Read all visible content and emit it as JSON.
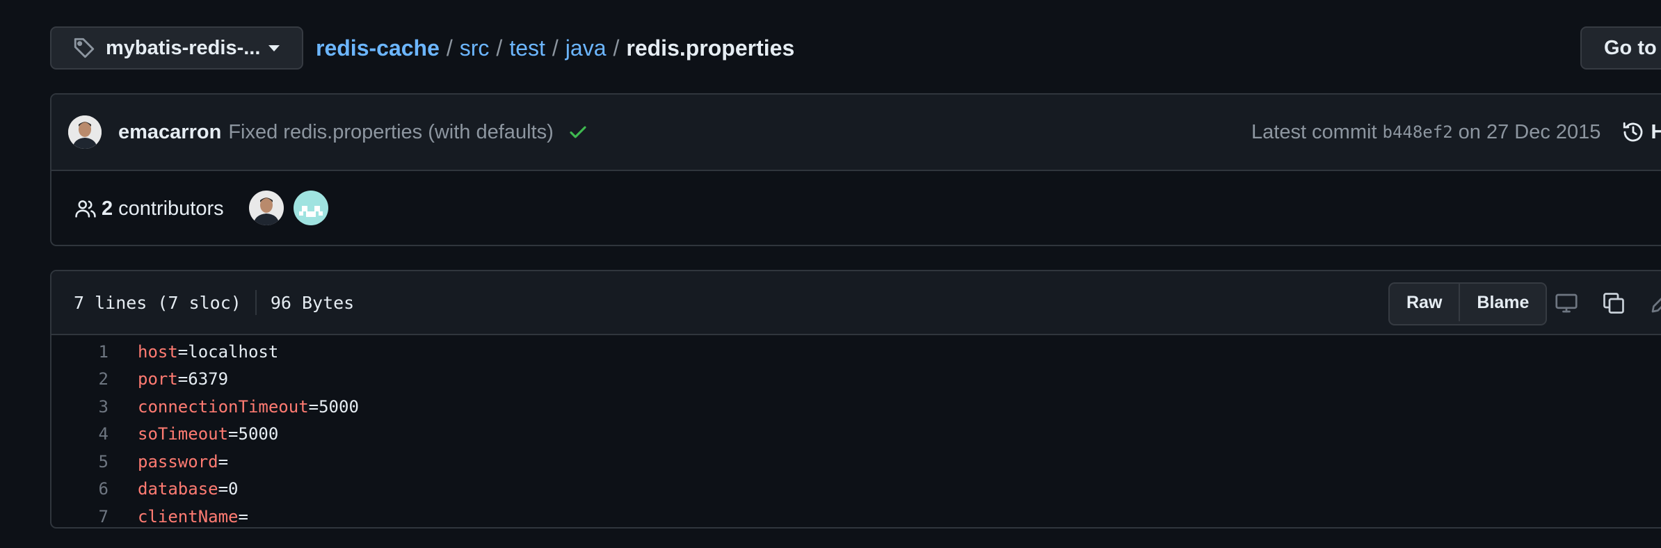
{
  "branch": {
    "label": "mybatis-redis-..."
  },
  "breadcrumb": {
    "repo": "redis-cache",
    "separator": "/",
    "segments": [
      "src",
      "test",
      "java"
    ],
    "file": "redis.properties"
  },
  "goto_file": {
    "label": "Go to file"
  },
  "commit": {
    "author": "emacarron",
    "message": "Fixed redis.properties (with defaults)",
    "latest_label": "Latest commit",
    "sha": "b448ef2",
    "date": "on 27 Dec 2015",
    "history_label": "H"
  },
  "contributors": {
    "count": "2",
    "label": "contributors"
  },
  "file": {
    "lines_info": "7 lines (7 sloc)",
    "size": "96 Bytes",
    "raw_label": "Raw",
    "blame_label": "Blame"
  },
  "code": {
    "lines": [
      {
        "num": "1",
        "key": "host",
        "eq": "=",
        "value": "localhost"
      },
      {
        "num": "2",
        "key": "port",
        "eq": "=",
        "value": "6379"
      },
      {
        "num": "3",
        "key": "connectionTimeout",
        "eq": "=",
        "value": "5000"
      },
      {
        "num": "4",
        "key": "soTimeout",
        "eq": "=",
        "value": "5000"
      },
      {
        "num": "5",
        "key": "password",
        "eq": "=",
        "value": ""
      },
      {
        "num": "6",
        "key": "database",
        "eq": "=",
        "value": "0"
      },
      {
        "num": "7",
        "key": "clientName",
        "eq": "=",
        "value": ""
      }
    ]
  },
  "colors": {
    "background": "#0d1117",
    "link": "#6cb6ff",
    "key": "#ff7b72",
    "success": "#3fb950"
  }
}
